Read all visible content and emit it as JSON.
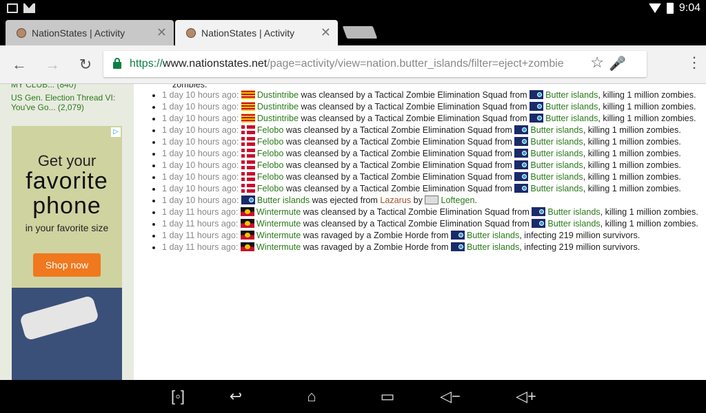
{
  "status": {
    "time": "9:04",
    "notif_icons": [
      "image-icon",
      "gmail-icon"
    ],
    "right_icons": [
      "wifi-icon",
      "battery-icon"
    ]
  },
  "tabs": [
    {
      "title": "NationStates | Activity",
      "active": false
    },
    {
      "title": "NationStates | Activity",
      "active": true
    }
  ],
  "toolbar": {
    "url_scheme": "https://",
    "url_host": "www.nationstates.net",
    "url_path": "/page=activity/view=nation.butter_islands/filter=eject+zombie"
  },
  "sidebar": {
    "link1": "MY CLUB... (840)",
    "link2": "US Gen. Election Thread VI:",
    "link2b": "You've Go... (2,079)",
    "ad": {
      "line1": "Get your",
      "line2a": "favorite",
      "line2b": "phone",
      "line3": "in your favorite size",
      "button": "Shop now"
    }
  },
  "feed": {
    "top_fragment": "zombies.",
    "events": [
      {
        "when": "1 day 10 hours ago:",
        "actor": "Dustintribe",
        "text": " was cleansed by a Tactical Zombie Elimination Squad from ",
        "target": "Butter islands",
        "tail": ", killing 1 million zombies."
      },
      {
        "when": "1 day 10 hours ago:",
        "actor": "Dustintribe",
        "text": " was cleansed by a Tactical Zombie Elimination Squad from ",
        "target": "Butter islands",
        "tail": ", killing 1 million zombies."
      },
      {
        "when": "1 day 10 hours ago:",
        "actor": "Dustintribe",
        "text": " was cleansed by a Tactical Zombie Elimination Squad from ",
        "target": "Butter islands",
        "tail": ", killing 1 million zombies."
      },
      {
        "when": "1 day 10 hours ago:",
        "actor": "Felobo",
        "text": " was cleansed by a Tactical Zombie Elimination Squad from ",
        "target": "Butter islands",
        "tail": ", killing 1 million zombies."
      },
      {
        "when": "1 day 10 hours ago:",
        "actor": "Felobo",
        "text": " was cleansed by a Tactical Zombie Elimination Squad from ",
        "target": "Butter islands",
        "tail": ", killing 1 million zombies."
      },
      {
        "when": "1 day 10 hours ago:",
        "actor": "Felobo",
        "text": " was cleansed by a Tactical Zombie Elimination Squad from ",
        "target": "Butter islands",
        "tail": ", killing 1 million zombies."
      },
      {
        "when": "1 day 10 hours ago:",
        "actor": "Felobo",
        "text": " was cleansed by a Tactical Zombie Elimination Squad from ",
        "target": "Butter islands",
        "tail": ", killing 1 million zombies."
      },
      {
        "when": "1 day 10 hours ago:",
        "actor": "Felobo",
        "text": " was cleansed by a Tactical Zombie Elimination Squad from ",
        "target": "Butter islands",
        "tail": ", killing 1 million zombies."
      },
      {
        "when": "1 day 10 hours ago:",
        "actor": "Felobo",
        "text": " was cleansed by a Tactical Zombie Elimination Squad from ",
        "target": "Butter islands",
        "tail": ", killing 1 million zombies."
      }
    ],
    "eject": {
      "when": "1 day 10 hours ago:",
      "nation": "Butter islands",
      "text1": " was ejected from ",
      "region": "Lazarus",
      "text2": " by ",
      "by": "Loftegen",
      "end": "."
    },
    "events2": [
      {
        "when": "1 day 11 hours ago:",
        "actor": "Wintermute",
        "text": " was cleansed by a Tactical Zombie Elimination Squad from ",
        "target": "Butter islands",
        "tail": ", killing 1 million zombies."
      },
      {
        "when": "1 day 11 hours ago:",
        "actor": "Wintermute",
        "text": " was cleansed by a Tactical Zombie Elimination Squad from ",
        "target": "Butter islands",
        "tail": ", killing 1 million zombies."
      },
      {
        "when": "1 day 11 hours ago:",
        "actor": "Wintermute",
        "text": " was ravaged by a Zombie Horde from ",
        "target": "Butter islands",
        "tail": ", infecting 219 million survivors."
      },
      {
        "when": "1 day 11 hours ago:",
        "actor": "Wintermute",
        "text": " was ravaged by a Zombie Horde from ",
        "target": "Butter islands",
        "tail": ", infecting 219 million survivors."
      }
    ]
  },
  "navbar": [
    "screenshot-icon",
    "back-icon",
    "home-icon",
    "recents-icon",
    "volume-down-icon",
    "volume-up-icon"
  ]
}
